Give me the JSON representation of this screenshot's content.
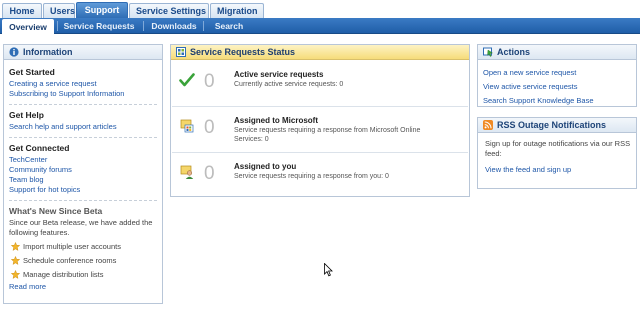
{
  "top_tabs": [
    {
      "label": "Home",
      "active": false
    },
    {
      "label": "Users",
      "active": false
    },
    {
      "label": "Support",
      "active": true
    },
    {
      "label": "Service Settings",
      "active": false
    },
    {
      "label": "Migration",
      "active": false
    }
  ],
  "sub_tabs": [
    {
      "label": "Overview",
      "active": true
    },
    {
      "label": "Service Requests",
      "active": false
    },
    {
      "label": "Downloads",
      "active": false
    },
    {
      "label": "Search",
      "active": false
    }
  ],
  "information": {
    "title": "Information",
    "get_started": {
      "title": "Get Started",
      "links": [
        "Creating a service request",
        "Subscribing to Support Information"
      ]
    },
    "get_help": {
      "title": "Get Help",
      "links": [
        "Search help and support articles"
      ]
    },
    "get_connected": {
      "title": "Get Connected",
      "links": [
        "TechCenter",
        "Community forums",
        "Team blog",
        "Support for hot topics"
      ]
    },
    "whats_new": {
      "title": "What's New Since Beta",
      "intro": "Since our Beta release, we have added the following features.",
      "items": [
        "Import multiple user accounts",
        "Schedule conference rooms",
        "Manage distribution lists"
      ],
      "read_more": "Read more"
    }
  },
  "status": {
    "title": "Service Requests Status",
    "rows": [
      {
        "count": "0",
        "title": "Active service requests",
        "desc": "Currently active service requests: 0",
        "icon": "check-icon"
      },
      {
        "count": "0",
        "title": "Assigned to Microsoft",
        "desc": "Service requests requiring a response from Microsoft Online Services: 0",
        "icon": "assigned-microsoft-icon"
      },
      {
        "count": "0",
        "title": "Assigned to you",
        "desc": "Service requests requiring a response from you: 0",
        "icon": "assigned-user-icon"
      }
    ]
  },
  "actions": {
    "title": "Actions",
    "links": [
      "Open a new service request",
      "View active service requests",
      "Search Support Knowledge Base"
    ]
  },
  "rss": {
    "title": "RSS Outage Notifications",
    "text": "Sign up for outage notifications via our RSS feed:",
    "link": "View the feed and sign up"
  },
  "colors": {
    "accent": "#2f6db5",
    "link": "#1f57a8",
    "status_header": "#fbe9a6"
  }
}
